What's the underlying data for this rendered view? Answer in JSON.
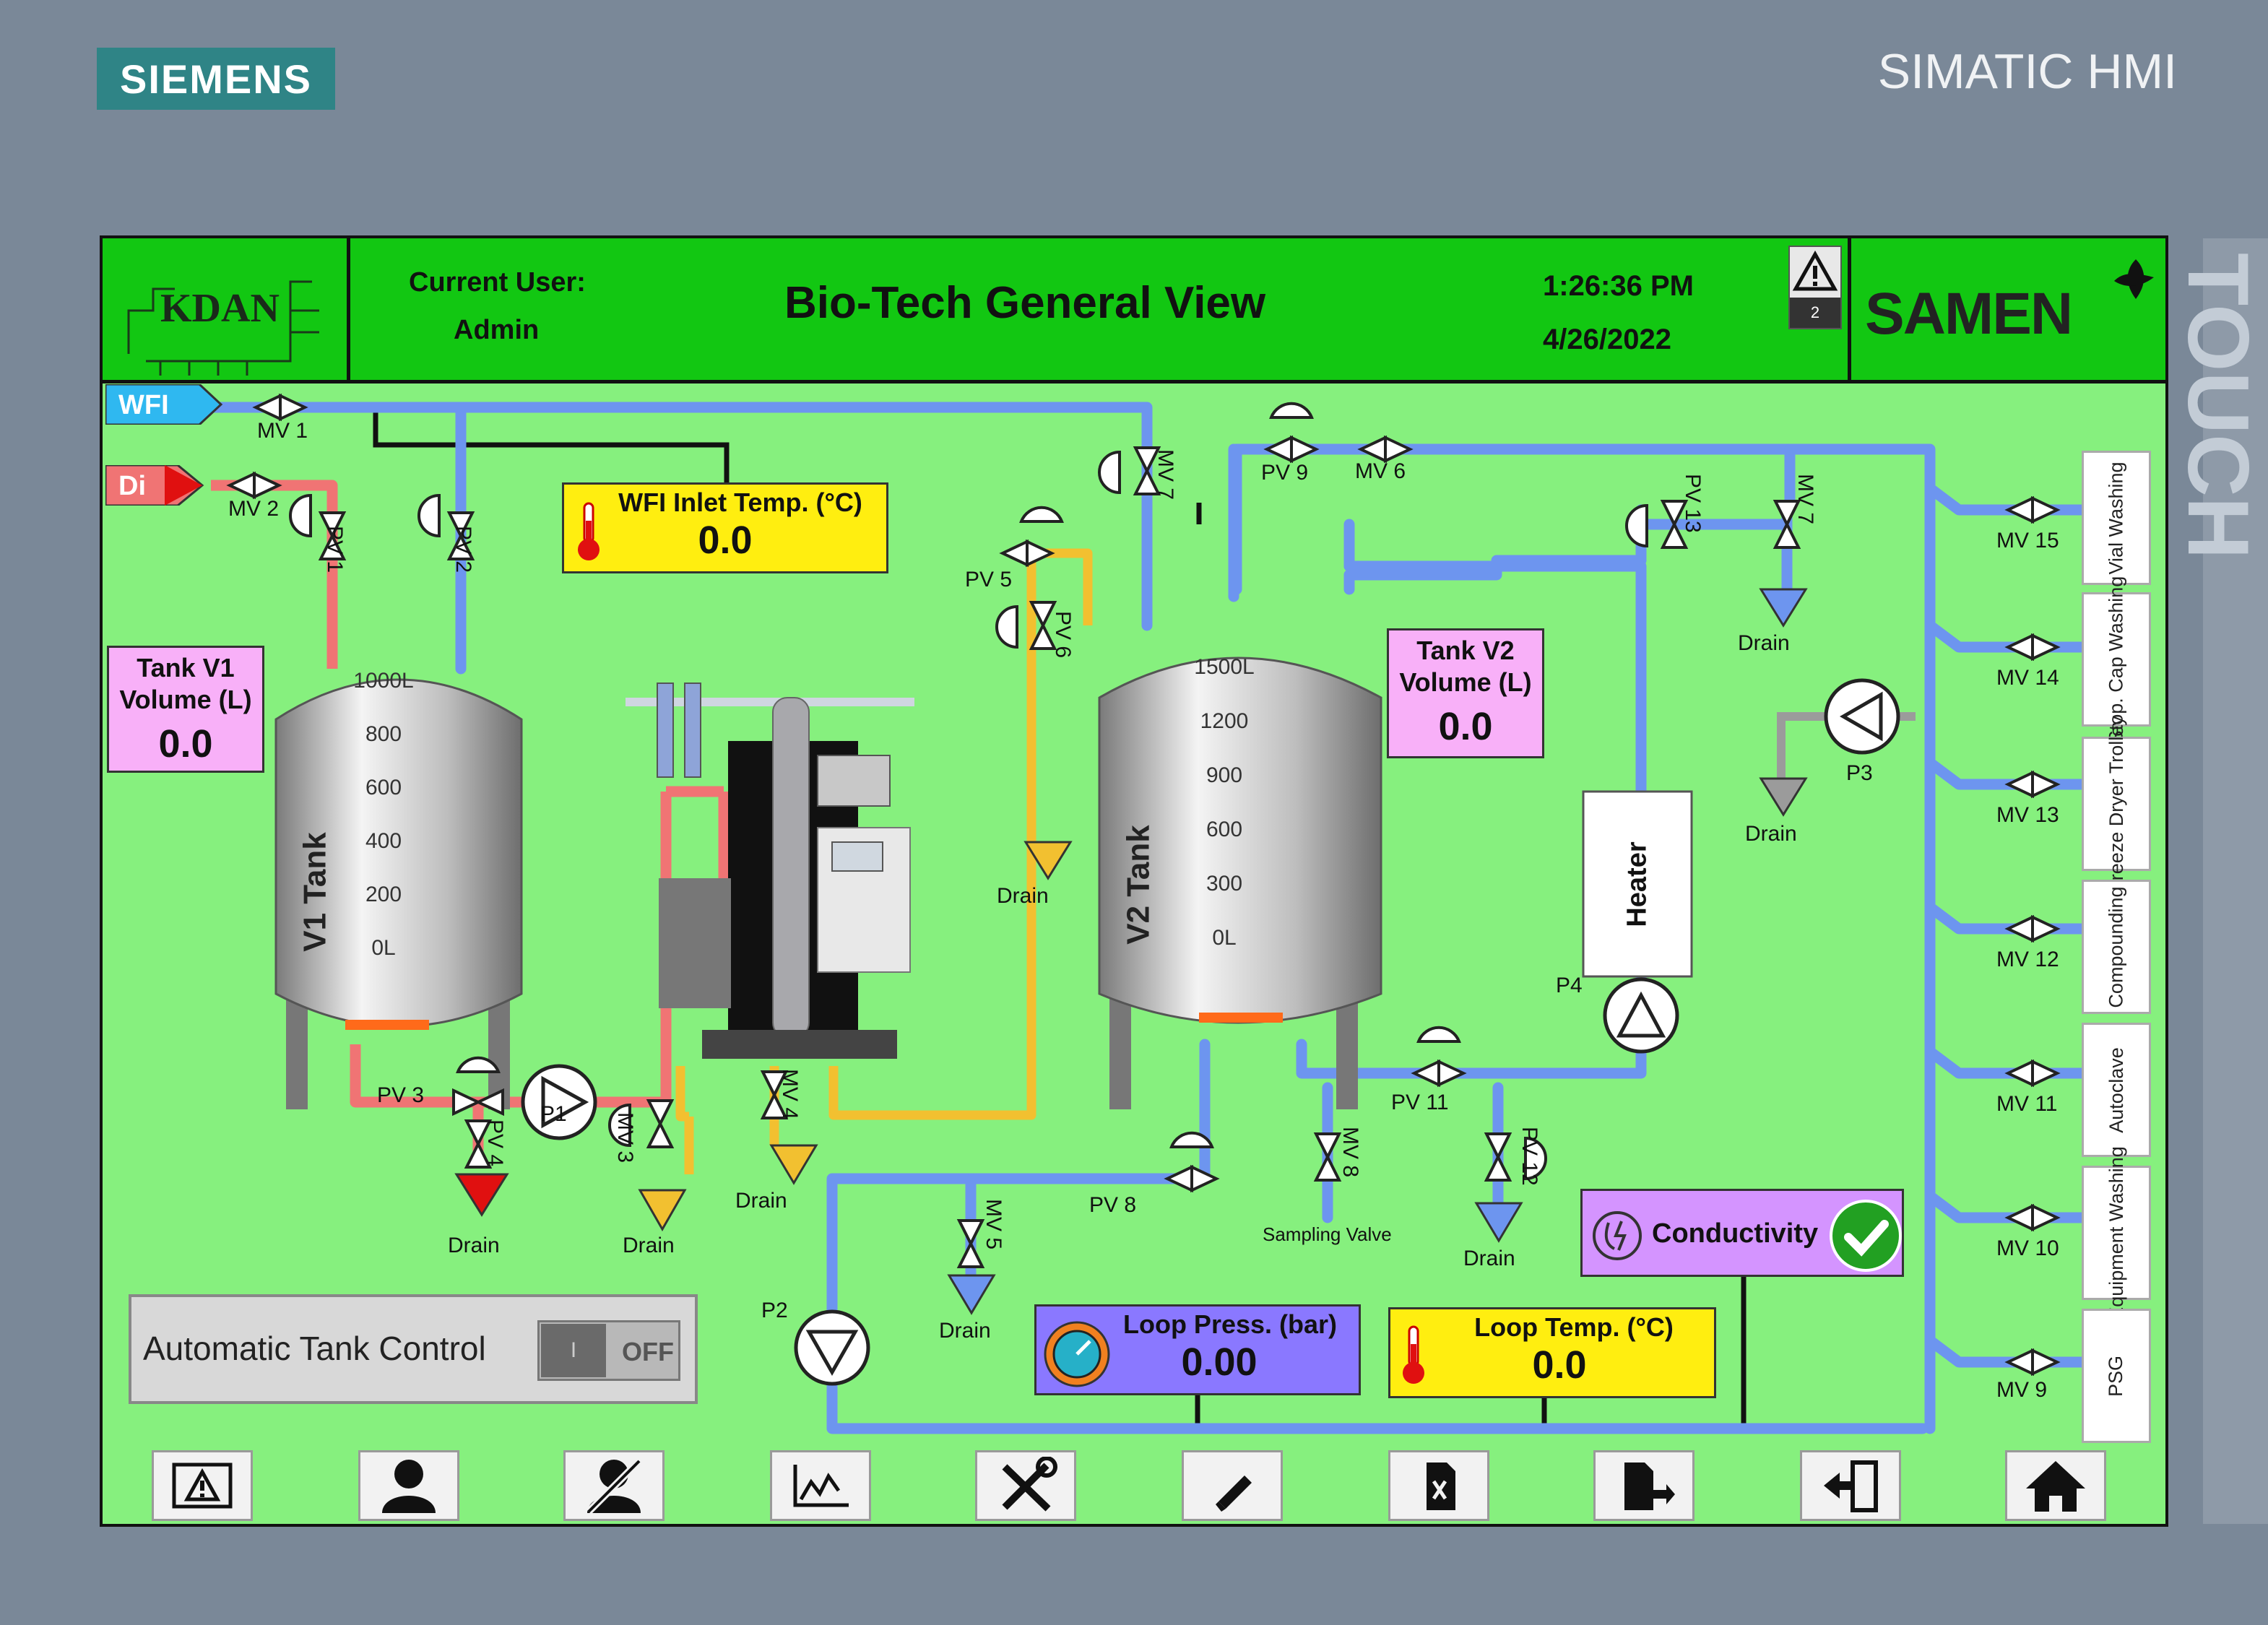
{
  "device": {
    "brand": "SIEMENS",
    "model": "SIMATIC HMI",
    "side_label": "TOUCH"
  },
  "header": {
    "logo_left": "KDAN",
    "logo_right": "SAMEN",
    "user_label": "Current User:",
    "user_name": "Admin",
    "title": "Bio-Tech General View",
    "time": "1:26:36 PM",
    "date": "4/26/2022",
    "alarm_count": "2"
  },
  "sources": {
    "wfi": "WFI",
    "di": "Di"
  },
  "valves": {
    "mv1": "MV 1",
    "mv2": "MV 2",
    "pv1": "PV 1",
    "pv2": "PV 2",
    "pv3": "PV 3",
    "pv4": "PV 4",
    "mv3": "MV 3",
    "mv4": "MV 4",
    "pv5": "PV 5",
    "pv6": "PV 6",
    "mv7": "MV 7",
    "pv9": "PV 9",
    "mv6": "MV 6",
    "pv13": "PV 13",
    "mv7b": "MV 7",
    "pv8": "PV 8",
    "mv5": "MV 5",
    "mv8": "MV 8",
    "pv11": "PV 11",
    "pv12": "PV 12",
    "mv15": "MV 15",
    "mv14": "MV 14",
    "mv13": "MV 13",
    "mv12": "MV 12",
    "mv11": "MV 11",
    "mv10": "MV 10",
    "mv9": "MV 9"
  },
  "pumps": {
    "p1": "P1",
    "p2": "P2",
    "p3": "P3",
    "p4": "P4"
  },
  "drain_label": "Drain",
  "sampling_label": "Sampling Valve",
  "heater_label": "Heater",
  "tank_v1": {
    "name": "V1 Tank",
    "scale": [
      "1000L",
      "800",
      "600",
      "400",
      "200",
      "0L"
    ],
    "volume_label": "Tank V1 Volume (L)",
    "volume": "0.0"
  },
  "tank_v2": {
    "name": "V2 Tank",
    "scale": [
      "1500L",
      "1200",
      "900",
      "600",
      "300",
      "0L"
    ],
    "volume_label": "Tank V2 Volume (L)",
    "volume": "0.0"
  },
  "wfi_temp": {
    "label": "WFI Inlet Temp. (°C)",
    "value": "0.0"
  },
  "loop_press": {
    "label": "Loop Press. (bar)",
    "value": "0.00"
  },
  "loop_temp": {
    "label": "Loop Temp. (°C)",
    "value": "0.0"
  },
  "conductivity": {
    "label": "Conductivity",
    "status": "ok"
  },
  "auto_control": {
    "label": "Automatic Tank Control",
    "toggle_on": "I",
    "toggle_off": "OFF",
    "state": "off"
  },
  "destinations": [
    "Vial Washing",
    "Stop. Cap Washing",
    "Freeze Dryer Trolley",
    "Compounding",
    "Autoclave",
    "Equipment Washing",
    "PSG"
  ],
  "nav_icons": [
    "alarm-screen-icon",
    "user-icon",
    "user-logoff-icon",
    "trend-icon",
    "tools-icon",
    "edit-icon",
    "report-icon",
    "recipe-icon",
    "exit-icon",
    "home-icon"
  ],
  "colors": {
    "screen_bg": "#86f07e",
    "header_bg": "#12c712",
    "pipe_wfi": "#6d95ef",
    "pipe_di": "#f07474",
    "pipe_drain": "#f2c030"
  }
}
